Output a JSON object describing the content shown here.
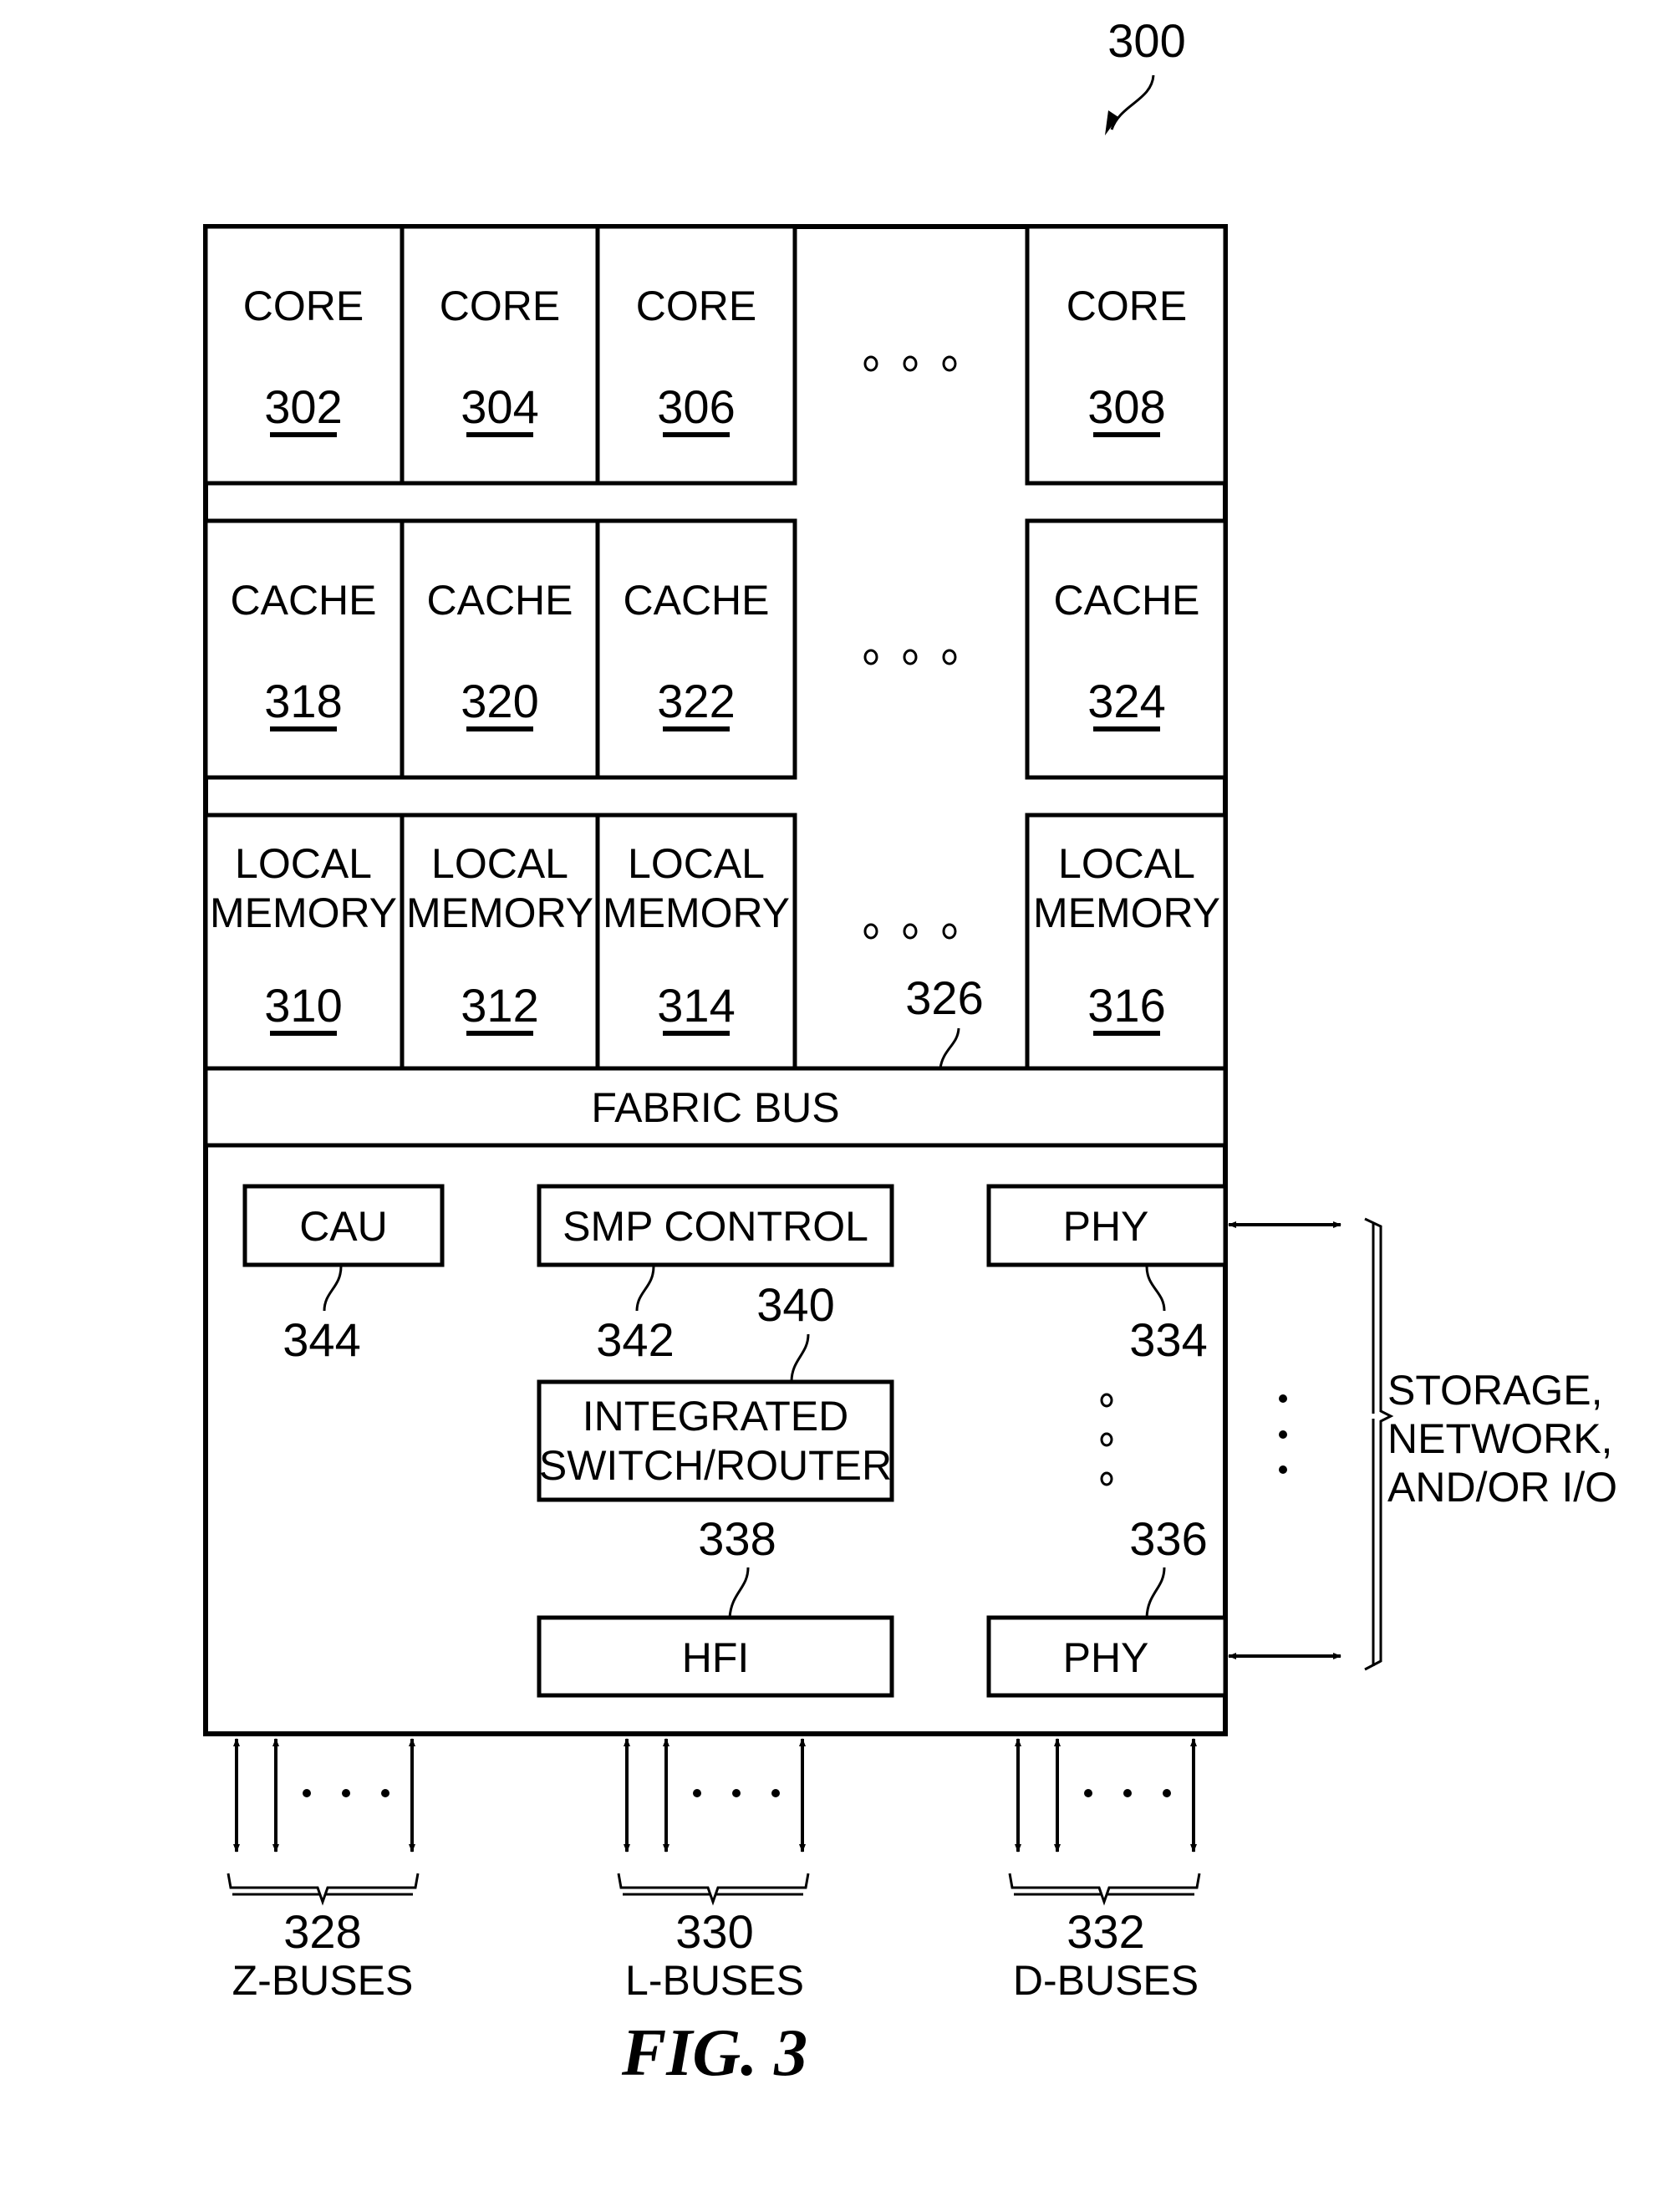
{
  "figure": {
    "reference": "300",
    "caption": "FIG. 3"
  },
  "cores": [
    {
      "label": "CORE",
      "ref": "302"
    },
    {
      "label": "CORE",
      "ref": "304"
    },
    {
      "label": "CORE",
      "ref": "306"
    },
    {
      "label": "CORE",
      "ref": "308"
    }
  ],
  "caches": [
    {
      "label": "CACHE",
      "ref": "318"
    },
    {
      "label": "CACHE",
      "ref": "320"
    },
    {
      "label": "CACHE",
      "ref": "322"
    },
    {
      "label": "CACHE",
      "ref": "324"
    }
  ],
  "local_memories": [
    {
      "line1": "LOCAL",
      "line2": "MEMORY",
      "ref": "310"
    },
    {
      "line1": "LOCAL",
      "line2": "MEMORY",
      "ref": "312"
    },
    {
      "line1": "LOCAL",
      "line2": "MEMORY",
      "ref": "314"
    },
    {
      "line1": "LOCAL",
      "line2": "MEMORY",
      "ref": "316"
    }
  ],
  "fabric_bus": {
    "label": "FABRIC BUS",
    "ref": "326"
  },
  "components": {
    "cau": {
      "label": "CAU",
      "ref": "344"
    },
    "smp_control": {
      "label": "SMP CONTROL",
      "ref": "342"
    },
    "switch_router": {
      "line1": "INTEGRATED",
      "line2": "SWITCH/ROUTER",
      "ref": "340"
    },
    "hfi": {
      "label": "HFI",
      "ref": "338"
    },
    "phy_top": {
      "label": "PHY",
      "ref": "334"
    },
    "phy_bottom": {
      "label": "PHY",
      "ref": "336"
    }
  },
  "external": {
    "line1": "STORAGE,",
    "line2": "NETWORK,",
    "line3": "AND/OR I/O"
  },
  "buses": [
    {
      "ref": "328",
      "label": "Z-BUSES"
    },
    {
      "ref": "330",
      "label": "L-BUSES"
    },
    {
      "ref": "332",
      "label": "D-BUSES"
    }
  ],
  "ellipsis_icon": "three-dots-icon"
}
